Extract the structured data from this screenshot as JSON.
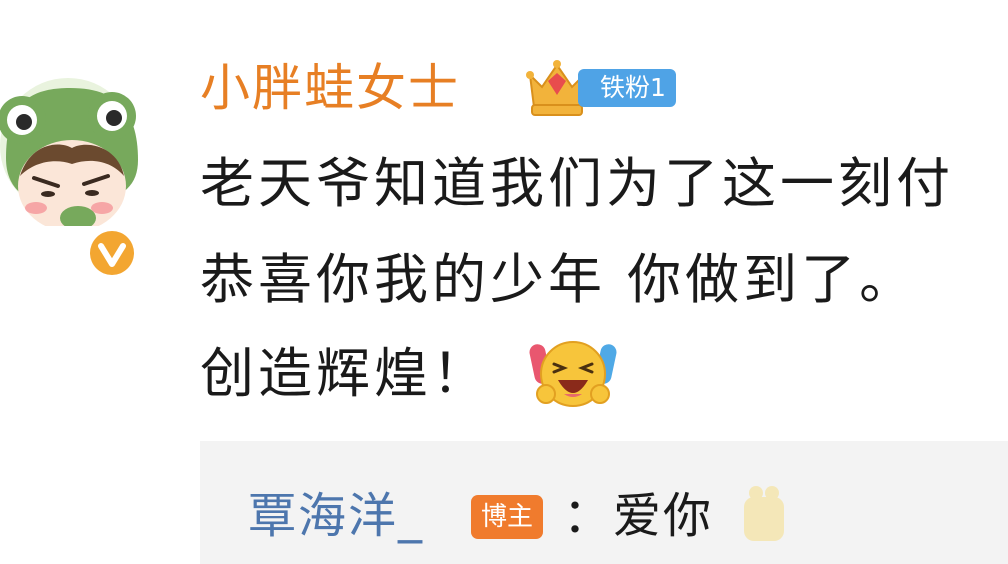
{
  "comment": {
    "username": "小胖蛙女士",
    "fan_badge": "铁粉1",
    "body_lines": [
      "老天爷知道我们为了这一刻付",
      "恭喜你我的少年 你做到了。",
      "创造辉煌！"
    ],
    "icons": {
      "avatar": "frog-hat-avatar",
      "verified": "verified-v-icon",
      "fan_crown": "crown-icon",
      "emoji": "laugh-tears-emoji-icon"
    }
  },
  "reply": {
    "author": "覃海洋_",
    "author_badge": "博主",
    "text": "：爱你",
    "emoji_icon": "partial-emoji-icon"
  },
  "colors": {
    "username": "#e77f24",
    "reply_author": "#4d76ad",
    "fan_pill": "#4fa3e6",
    "author_badge": "#f07b2d",
    "reply_background": "#f3f3f3"
  }
}
